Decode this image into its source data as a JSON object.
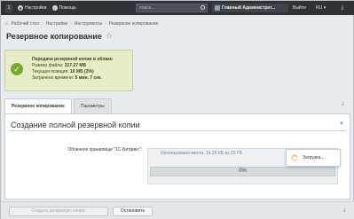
{
  "topbar": {
    "badge_count": "1",
    "settings_label": "Настройки",
    "help_label": "Помощь",
    "search_placeholder": "поиск...",
    "user_name": "Главный Администрат...",
    "logout_label": "Выйти",
    "lang_label": "RU",
    "pin_icon": "pin-icon"
  },
  "breadcrumb": {
    "items": [
      "Рабочий стол",
      "Настройки",
      "Инструменты",
      "Резервное копирование"
    ]
  },
  "page": {
    "title": "Резервное копирование"
  },
  "status": {
    "heading": "Передача резервной копии в облако",
    "size_label": "Размер файла:",
    "size_value": "317.27 МБ",
    "position_label": "Текущая позиция:",
    "position_value": "10 МБ (3%)",
    "time_label": "Затрачено времени:",
    "time_value": "5 мин. 7 сек.",
    "color": "#e7edc6",
    "icon": "check-icon"
  },
  "tabs": [
    {
      "label": "Резервное копирование",
      "active": true
    },
    {
      "label": "Параметры",
      "active": false
    }
  ],
  "section": {
    "title": "Создание полной резервной копии",
    "field_label": "Облачное хранилище \"1С-Битрикс\":",
    "usage_text": "Использовано места: 14.26 КБ из 25 ГБ",
    "progress_percent": 0,
    "progress_label": "0%"
  },
  "loader": {
    "label": "Загрузка..."
  },
  "buttons": {
    "create_label": "Создать резервную копию",
    "stop_label": "Остановить"
  }
}
